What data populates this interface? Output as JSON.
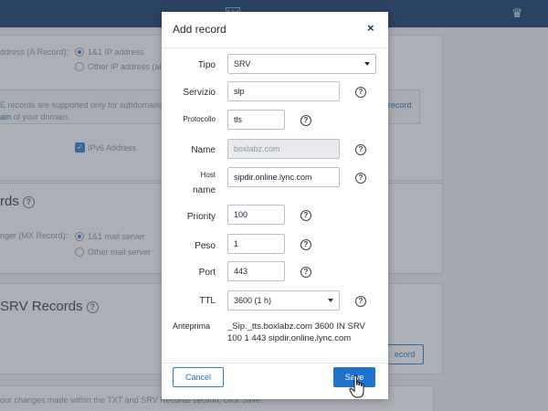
{
  "background": {
    "a_record_label": "ddress (A Record):",
    "ip_option_1": "1&1 IP address",
    "ip_option_2": "Other IP address (als",
    "info_text": "E records are supported only for subdomains.",
    "info_link": "ain",
    "info_tail": "of your domain.",
    "record_link": "record",
    "ipv6_label": "IPv6 Address",
    "mx_heading": "rds",
    "mx_label": "nger (MX Record):",
    "mail_option_1": "1&1 mail server",
    "mail_option_2": "Other mail server",
    "srv_heading": "SRV Records",
    "add_record_btn": "ecord",
    "footer_text": "our changes made within the TXT and SRV Records section, click Save."
  },
  "dialog": {
    "title": "Add record",
    "close_symbol": "×",
    "fields": {
      "tipo": {
        "label": "Tipo",
        "value": "SRV"
      },
      "servizio": {
        "label": "Servizio",
        "value": "sip"
      },
      "protocollo": {
        "label": "Protocollo",
        "value": "tls"
      },
      "name": {
        "label": "Name",
        "value": "boxlabz.com"
      },
      "host_line1": "Host",
      "host_line2": "name",
      "host_value": "sipdir.online.lync.com",
      "priority": {
        "label": "Priority",
        "value": "100"
      },
      "peso": {
        "label": "Peso",
        "value": "1"
      },
      "port": {
        "label": "Port",
        "value": "443"
      },
      "ttl": {
        "label": "TTL",
        "value": "3600 (1 h)"
      }
    },
    "help_symbol": "?",
    "preview_label": "Anteprima",
    "preview_line1": "_Sip._tts.boxlabz.com 3600 IN SRV",
    "preview_line2": "100 1 443 sipdir.online.lync.com",
    "cancel_label": "Cancel",
    "save_label": "Save"
  }
}
